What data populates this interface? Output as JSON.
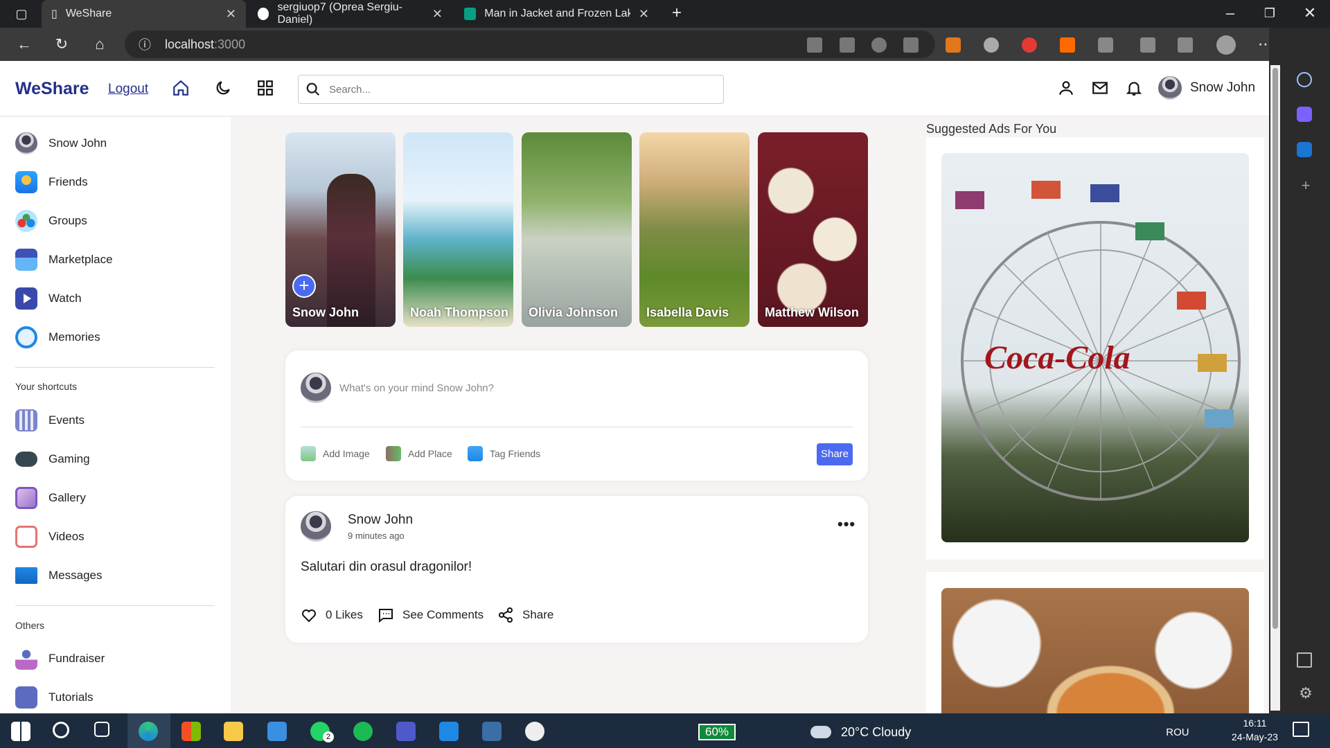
{
  "browser": {
    "tabs": [
      {
        "title": "WeShare",
        "active": true
      },
      {
        "title": "sergiuop7 (Oprea Sergiu-Daniel)",
        "active": false
      },
      {
        "title": "Man in Jacket and Frozen Lake ar",
        "active": false
      }
    ],
    "url_host": "localhost",
    "url_port": ":3000"
  },
  "app": {
    "logo": "WeShare",
    "logout": "Logout",
    "search_placeholder": "Search...",
    "user_name": "Snow John",
    "accent": "#4c6af0",
    "brand": "#22308a"
  },
  "sidebar": {
    "main": [
      {
        "label": "Snow John",
        "icon": "avatar"
      },
      {
        "label": "Friends",
        "icon": "friends-icon"
      },
      {
        "label": "Groups",
        "icon": "groups-icon"
      },
      {
        "label": "Marketplace",
        "icon": "marketplace-icon"
      },
      {
        "label": "Watch",
        "icon": "watch-icon"
      },
      {
        "label": "Memories",
        "icon": "memories-icon"
      }
    ],
    "shortcuts_title": "Your shortcuts",
    "shortcuts": [
      {
        "label": "Events",
        "icon": "events-icon"
      },
      {
        "label": "Gaming",
        "icon": "gaming-icon"
      },
      {
        "label": "Gallery",
        "icon": "gallery-icon"
      },
      {
        "label": "Videos",
        "icon": "videos-icon"
      },
      {
        "label": "Messages",
        "icon": "messages-icon"
      }
    ],
    "others_title": "Others",
    "others": [
      {
        "label": "Fundraiser",
        "icon": "fundraiser-icon"
      },
      {
        "label": "Tutorials",
        "icon": "tutorials-icon"
      }
    ]
  },
  "stories": [
    "Snow John",
    "Noah Thompson",
    "Olivia Johnson",
    "Isabella Davis",
    "Matthew Wilson"
  ],
  "composer": {
    "placeholder": "What's on your mind Snow John?",
    "add_image": "Add Image",
    "add_place": "Add Place",
    "tag_friends": "Tag Friends",
    "share": "Share"
  },
  "post": {
    "author": "Snow John",
    "time": "9 minutes ago",
    "text": "Salutari din orasul dragonilor!",
    "likes": "0 Likes",
    "comments": "See Comments",
    "share": "Share"
  },
  "ads": {
    "title": "Suggested Ads For You",
    "brand_text": "Coca-Cola"
  },
  "taskbar": {
    "battery": "60%",
    "weather": "20°C  Cloudy",
    "lang": "ROU",
    "time": "16:11",
    "date": "24-May-23",
    "whatsapp_badge": "2"
  }
}
